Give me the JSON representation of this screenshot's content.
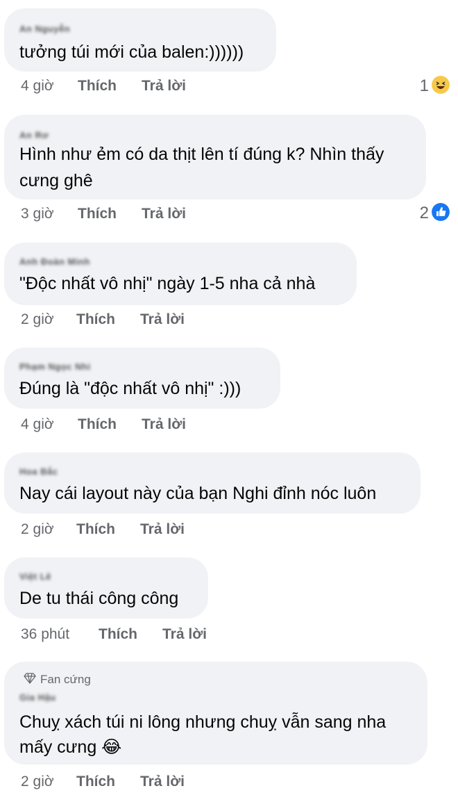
{
  "labels": {
    "like": "Thích",
    "reply": "Trả lời"
  },
  "comments": [
    {
      "name": "An Nguyễn",
      "text": "tưởng túi mới của balen:))))))",
      "time": "4 giờ",
      "reaction_count": "1",
      "reaction": "haha-icon"
    },
    {
      "name": "An Rơ",
      "text_line1": "Hình như ẻm có da thịt lên tí đúng k? Nhìn thấy",
      "text_line2": "cưng ghê",
      "time": "3 giờ",
      "reaction_count": "2",
      "reaction": "like-icon"
    },
    {
      "name": "Anh Đoàn Minh",
      "text": "\"Độc nhất vô nhị\" ngày 1-5 nha cả nhà",
      "time": "2 giờ"
    },
    {
      "name": "Phạm Ngọc Nhi",
      "text": "Đúng là \"độc nhất vô nhị\" :)))",
      "time": "4 giờ"
    },
    {
      "name": "Hoa Bắc",
      "text": "Nay cái layout này của bạn Nghi đỉnh nóc luôn",
      "time": "2 giờ"
    },
    {
      "name": "Việt Lê",
      "text": "De tu thái công công",
      "time": "36 phút"
    },
    {
      "badge": "Fan cứng",
      "name": "Gia Hậu",
      "text_line1": "Chuỵ xách túi ni lông nhưng chuỵ vẫn sang nha",
      "text_line2": "mấy cưng 😂",
      "time": "2 giờ"
    }
  ]
}
